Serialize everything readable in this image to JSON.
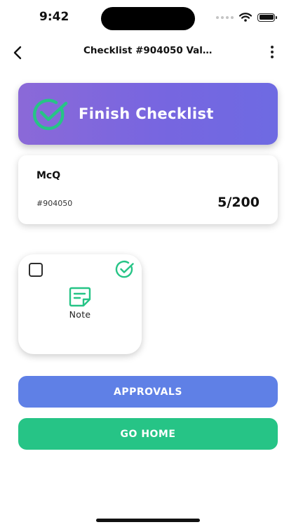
{
  "status_bar": {
    "time": "9:42",
    "icons": [
      "signal-dots-icon",
      "wifi-icon",
      "battery-icon"
    ]
  },
  "header": {
    "title": "Checklist #904050 Vali...",
    "back_icon": "chevron-left-icon",
    "menu_icon": "more-vertical-icon"
  },
  "finish_card": {
    "label": "Finish Checklist",
    "icon": "check-circle-icon",
    "accent": "#7766e0",
    "icon_color": "#26c486"
  },
  "info_card": {
    "name": "McQ",
    "id": "#904050",
    "count": "5/200"
  },
  "note_tile": {
    "label": "Note",
    "checked": false,
    "icon": "sticky-note-icon",
    "status_icon": "check-circle-icon",
    "icon_color": "#26c486"
  },
  "actions": {
    "approvals_label": "APPROVALS",
    "approvals_color": "#5f80e6",
    "home_label": "GO HOME",
    "home_color": "#26c486"
  }
}
